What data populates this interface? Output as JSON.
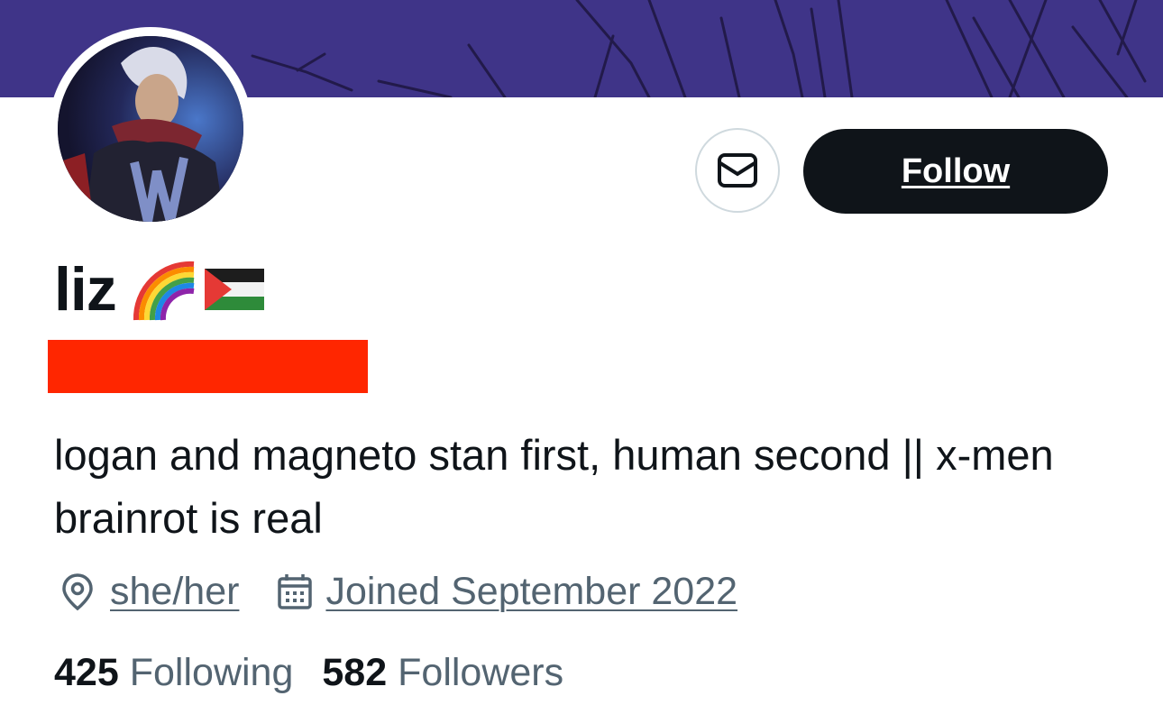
{
  "profile": {
    "display_name": "liz",
    "name_emojis": [
      "rainbow-emoji",
      "palestine-flag-emoji"
    ],
    "bio": "logan and magneto stan first, human second || x-men brainrot is real",
    "pronouns": "she/her",
    "joined": "Joined September 2022"
  },
  "actions": {
    "follow_label": "Follow",
    "message_icon": "mail-icon"
  },
  "stats": {
    "following_count": "425",
    "following_label": "Following",
    "followers_count": "582",
    "followers_label": "Followers"
  },
  "colors": {
    "banner": "#3f3488",
    "follow_button": "#0f1419",
    "redaction": "#ff2600",
    "secondary_text": "#536471"
  }
}
